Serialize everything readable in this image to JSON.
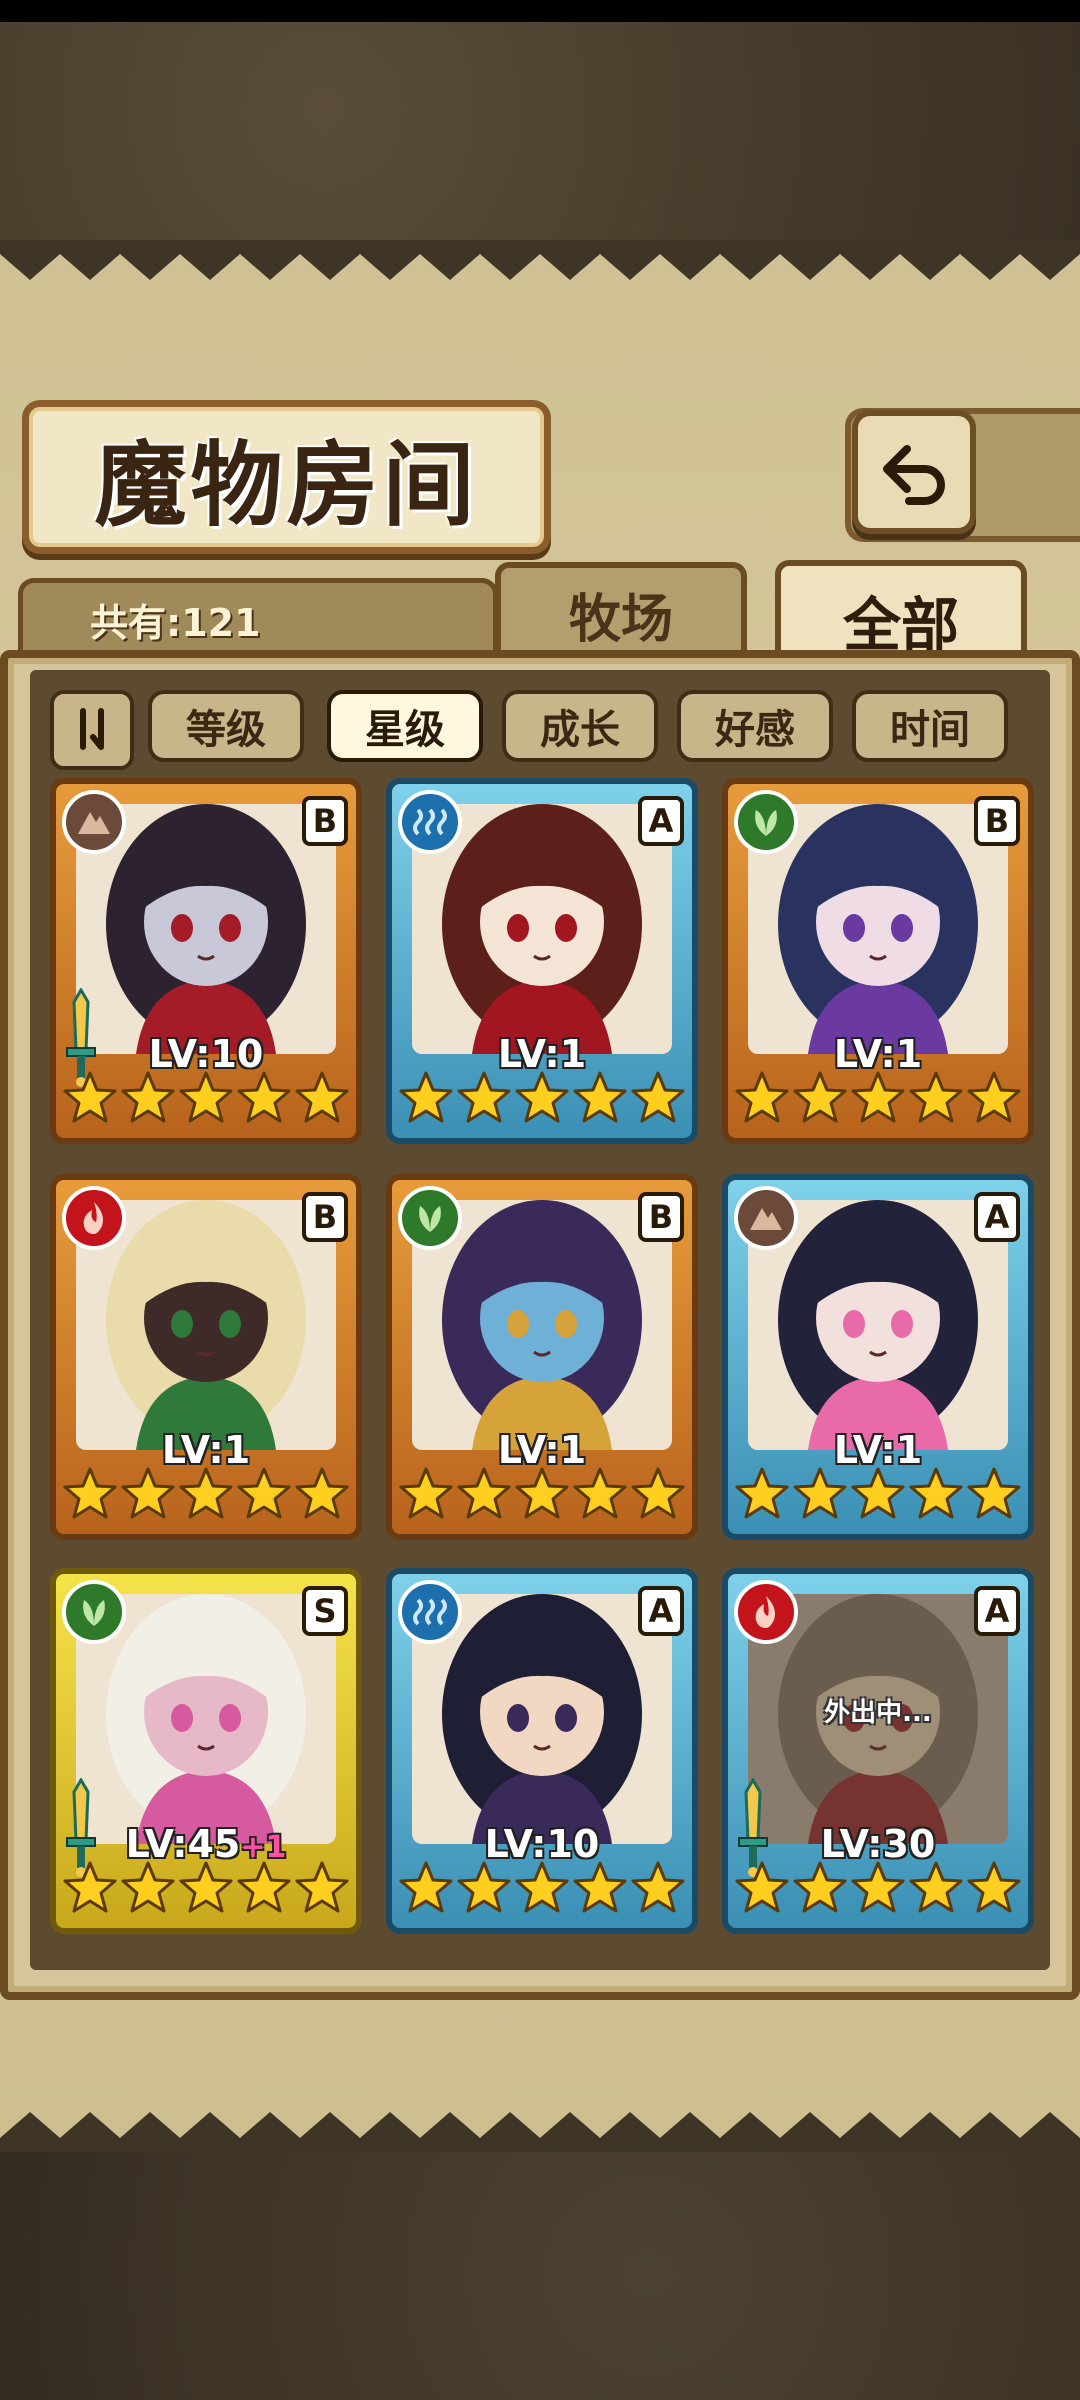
{
  "title": "魔物房间",
  "total_count": "共有:121",
  "tabs": {
    "farm": "牧场",
    "all": "全部"
  },
  "sort": {
    "toggle_icon": "sort-order-icon",
    "buttons": [
      {
        "label": "等级",
        "active": false
      },
      {
        "label": "星级",
        "active": true
      },
      {
        "label": "成长",
        "active": false
      },
      {
        "label": "好感",
        "active": false
      },
      {
        "label": "时间",
        "active": false
      }
    ]
  },
  "monsters": [
    {
      "level": "LV:10",
      "bonus": "",
      "rank": "B",
      "element": "earth",
      "frame": "gold",
      "stars": 5,
      "equipped": true,
      "status": ""
    },
    {
      "level": "LV:1",
      "bonus": "",
      "rank": "A",
      "element": "water",
      "frame": "blue",
      "stars": 5,
      "equipped": false,
      "status": ""
    },
    {
      "level": "LV:1",
      "bonus": "",
      "rank": "B",
      "element": "wood",
      "frame": "gold",
      "stars": 5,
      "equipped": false,
      "status": ""
    },
    {
      "level": "LV:1",
      "bonus": "",
      "rank": "B",
      "element": "fire",
      "frame": "gold",
      "stars": 5,
      "equipped": false,
      "status": ""
    },
    {
      "level": "LV:1",
      "bonus": "",
      "rank": "B",
      "element": "wood",
      "frame": "gold",
      "stars": 5,
      "equipped": false,
      "status": ""
    },
    {
      "level": "LV:1",
      "bonus": "",
      "rank": "A",
      "element": "earth",
      "frame": "blue",
      "stars": 5,
      "equipped": false,
      "status": ""
    },
    {
      "level": "LV:45",
      "bonus": "+1",
      "rank": "S",
      "element": "wood",
      "frame": "yellow",
      "stars": 5,
      "equipped": true,
      "status": ""
    },
    {
      "level": "LV:10",
      "bonus": "",
      "rank": "A",
      "element": "water",
      "frame": "blue",
      "stars": 5,
      "equipped": false,
      "status": ""
    },
    {
      "level": "LV:30",
      "bonus": "",
      "rank": "A",
      "element": "fire",
      "frame": "blue",
      "stars": 5,
      "equipped": true,
      "status": "外出中..."
    }
  ],
  "colors": {
    "earth": "#6b4a3a",
    "water": "#1d6fae",
    "wood": "#2e7a2a",
    "fire": "#c4141b"
  }
}
